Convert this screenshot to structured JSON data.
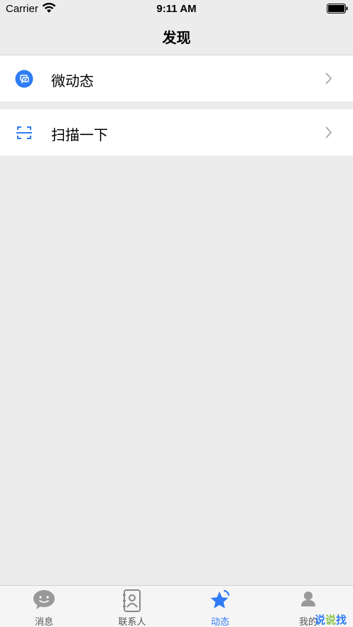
{
  "status_bar": {
    "carrier": "Carrier",
    "time": "9:11 AM"
  },
  "nav": {
    "title": "发现"
  },
  "cells": [
    {
      "label": "微动态",
      "icon": "chat-bubble-icon"
    },
    {
      "label": "扫描一下",
      "icon": "scan-icon"
    }
  ],
  "tabs": [
    {
      "label": "消息",
      "icon": "message-icon",
      "active": false
    },
    {
      "label": "联系人",
      "icon": "contacts-icon",
      "active": false
    },
    {
      "label": "动态",
      "icon": "star-icon",
      "active": true
    },
    {
      "label": "我的",
      "icon": "person-icon",
      "active": false
    }
  ],
  "watermark": {
    "c1": "说",
    "c2": "说",
    "c3": "找"
  },
  "colors": {
    "accent": "#2f7cf6",
    "background": "#ececec",
    "tab_inactive": "#888888"
  }
}
